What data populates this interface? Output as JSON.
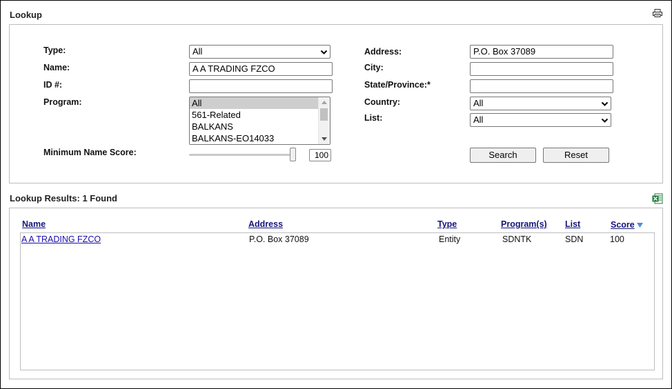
{
  "lookup": {
    "title": "Lookup",
    "print_icon": "printer-icon"
  },
  "form": {
    "type_label": "Type:",
    "type_value": "All",
    "name_label": "Name:",
    "name_value": "A A TRADING FZCO",
    "id_label": "ID #:",
    "id_value": "",
    "program_label": "Program:",
    "program_options": [
      "All",
      "561-Related",
      "BALKANS",
      "BALKANS-EO14033"
    ],
    "program_selected": "All",
    "min_score_label": "Minimum Name Score:",
    "min_score_value": "100",
    "min_score_fraction": 1.0,
    "address_label": "Address:",
    "address_value": "P.O. Box 37089",
    "city_label": "City:",
    "city_value": "",
    "state_label": "State/Province:*",
    "state_value": "",
    "country_label": "Country:",
    "country_value": "All",
    "list_label": "List:",
    "list_value": "All",
    "search_label": "Search",
    "reset_label": "Reset"
  },
  "results": {
    "title": "Lookup Results: 1 Found",
    "export_icon": "excel-export-icon",
    "columns": {
      "name": "Name",
      "address": "Address",
      "type": "Type",
      "programs": "Program(s)",
      "list": "List",
      "score": "Score"
    },
    "sort_icon": "sort-descending-icon",
    "rows": [
      {
        "name": "A A TRADING FZCO",
        "address": "P.O. Box 37089",
        "type": "Entity",
        "programs": "SDNTK",
        "list": "SDN",
        "score": "100"
      }
    ]
  },
  "colors": {
    "link": "#1a0dab",
    "header_link": "#15157a",
    "panel_border": "#bdbdbd",
    "selected_option": "#cecece",
    "excel_green": "#1d7a3a"
  }
}
